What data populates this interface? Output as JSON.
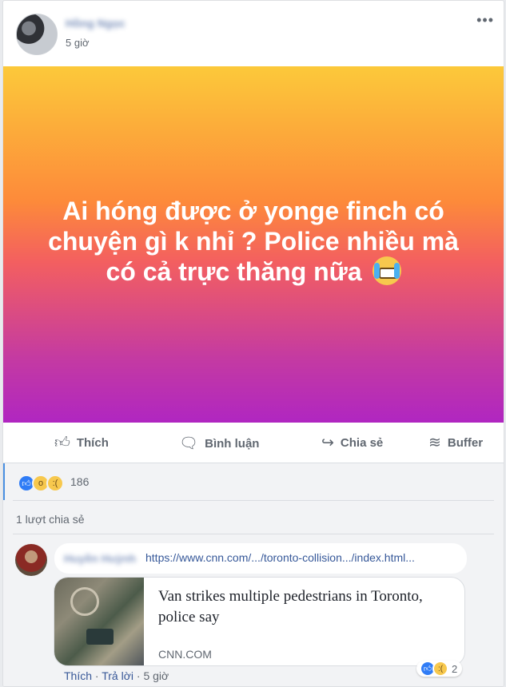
{
  "post": {
    "author_name": "Hồng Ngọc",
    "time": "5 giờ",
    "more_glyph": "•••",
    "text": "Ai hóng được ở yonge finch có chuyện gì k nhỉ ? Police nhiều mà có cả trực thăng nữa",
    "emoji": "crying-face"
  },
  "actions": {
    "like": "Thích",
    "comment": "Bình luận",
    "share": "Chia sẻ",
    "buffer": "Buffer"
  },
  "reactions": {
    "types": [
      "like",
      "wow",
      "sad"
    ],
    "count": "186"
  },
  "shares": "1 lượt chia sẻ",
  "comment": {
    "author": "Huyền Huỳnh",
    "link_text": "https://www.cnn.com/.../toronto-collision.../index.html...",
    "link_card": {
      "title": "Van strikes multiple pedestrians in Toronto, police say",
      "domain": "CNN.COM"
    },
    "reactions": {
      "types": [
        "like",
        "sad"
      ],
      "count": "2"
    },
    "like_label": "Thích",
    "reply_label": "Trả lời",
    "time": "5 giờ",
    "separator": "·"
  },
  "colors": {
    "gradient_top": "#fcc93a",
    "gradient_bottom": "#b026c1",
    "link": "#385898",
    "like_blue": "#2f7cf6"
  }
}
